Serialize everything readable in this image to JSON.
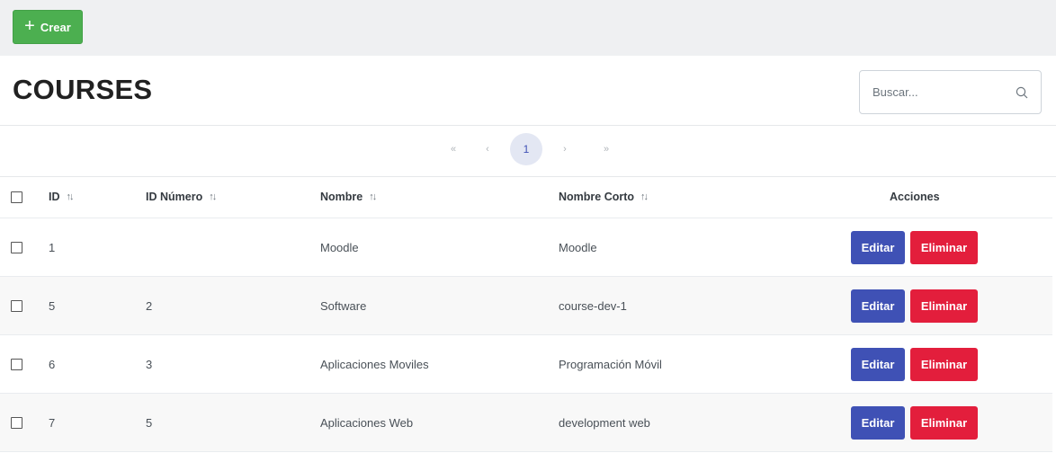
{
  "toolbar": {
    "create_label": "Crear",
    "create_icon": "plus-icon"
  },
  "page": {
    "title": "COURSES"
  },
  "search": {
    "placeholder": "Buscar...",
    "icon": "search-icon"
  },
  "pagination": {
    "first": "«",
    "prev": "‹",
    "current": "1",
    "next": "›",
    "last": "»"
  },
  "table": {
    "headers": {
      "id": "ID",
      "id_numero": "ID Número",
      "nombre": "Nombre",
      "nombre_corto": "Nombre Corto",
      "acciones": "Acciones"
    },
    "rows": [
      {
        "id": "1",
        "id_numero": "",
        "nombre": "Moodle",
        "nombre_corto": "Moodle"
      },
      {
        "id": "5",
        "id_numero": "2",
        "nombre": "Software",
        "nombre_corto": "course-dev-1"
      },
      {
        "id": "6",
        "id_numero": "3",
        "nombre": "Aplicaciones Moviles",
        "nombre_corto": "Programación Móvil"
      },
      {
        "id": "7",
        "id_numero": "5",
        "nombre": "Aplicaciones Web",
        "nombre_corto": "development web"
      }
    ],
    "actions": {
      "edit_label": "Editar",
      "delete_label": "Eliminar"
    }
  },
  "colors": {
    "create": "#4caf50",
    "edit": "#3f51b5",
    "delete": "#e31e3c",
    "toolbar_bg": "#eff0f2"
  }
}
